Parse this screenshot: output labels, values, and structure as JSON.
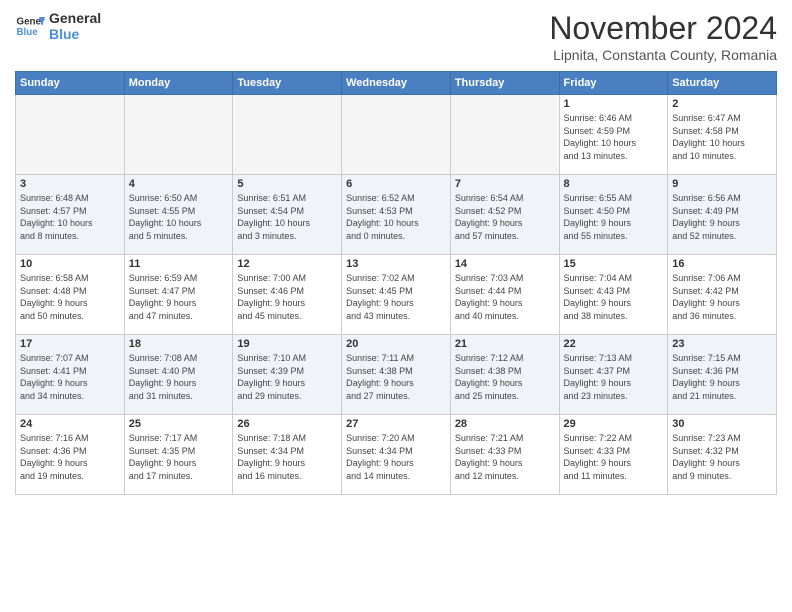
{
  "logo": {
    "line1": "General",
    "line2": "Blue"
  },
  "title": "November 2024",
  "subtitle": "Lipnita, Constanta County, Romania",
  "days_of_week": [
    "Sunday",
    "Monday",
    "Tuesday",
    "Wednesday",
    "Thursday",
    "Friday",
    "Saturday"
  ],
  "weeks": [
    [
      {
        "day": "",
        "info": "",
        "empty": true
      },
      {
        "day": "",
        "info": "",
        "empty": true
      },
      {
        "day": "",
        "info": "",
        "empty": true
      },
      {
        "day": "",
        "info": "",
        "empty": true
      },
      {
        "day": "",
        "info": "",
        "empty": true
      },
      {
        "day": "1",
        "info": "Sunrise: 6:46 AM\nSunset: 4:59 PM\nDaylight: 10 hours\nand 13 minutes."
      },
      {
        "day": "2",
        "info": "Sunrise: 6:47 AM\nSunset: 4:58 PM\nDaylight: 10 hours\nand 10 minutes."
      }
    ],
    [
      {
        "day": "3",
        "info": "Sunrise: 6:48 AM\nSunset: 4:57 PM\nDaylight: 10 hours\nand 8 minutes."
      },
      {
        "day": "4",
        "info": "Sunrise: 6:50 AM\nSunset: 4:55 PM\nDaylight: 10 hours\nand 5 minutes."
      },
      {
        "day": "5",
        "info": "Sunrise: 6:51 AM\nSunset: 4:54 PM\nDaylight: 10 hours\nand 3 minutes."
      },
      {
        "day": "6",
        "info": "Sunrise: 6:52 AM\nSunset: 4:53 PM\nDaylight: 10 hours\nand 0 minutes."
      },
      {
        "day": "7",
        "info": "Sunrise: 6:54 AM\nSunset: 4:52 PM\nDaylight: 9 hours\nand 57 minutes."
      },
      {
        "day": "8",
        "info": "Sunrise: 6:55 AM\nSunset: 4:50 PM\nDaylight: 9 hours\nand 55 minutes."
      },
      {
        "day": "9",
        "info": "Sunrise: 6:56 AM\nSunset: 4:49 PM\nDaylight: 9 hours\nand 52 minutes."
      }
    ],
    [
      {
        "day": "10",
        "info": "Sunrise: 6:58 AM\nSunset: 4:48 PM\nDaylight: 9 hours\nand 50 minutes."
      },
      {
        "day": "11",
        "info": "Sunrise: 6:59 AM\nSunset: 4:47 PM\nDaylight: 9 hours\nand 47 minutes."
      },
      {
        "day": "12",
        "info": "Sunrise: 7:00 AM\nSunset: 4:46 PM\nDaylight: 9 hours\nand 45 minutes."
      },
      {
        "day": "13",
        "info": "Sunrise: 7:02 AM\nSunset: 4:45 PM\nDaylight: 9 hours\nand 43 minutes."
      },
      {
        "day": "14",
        "info": "Sunrise: 7:03 AM\nSunset: 4:44 PM\nDaylight: 9 hours\nand 40 minutes."
      },
      {
        "day": "15",
        "info": "Sunrise: 7:04 AM\nSunset: 4:43 PM\nDaylight: 9 hours\nand 38 minutes."
      },
      {
        "day": "16",
        "info": "Sunrise: 7:06 AM\nSunset: 4:42 PM\nDaylight: 9 hours\nand 36 minutes."
      }
    ],
    [
      {
        "day": "17",
        "info": "Sunrise: 7:07 AM\nSunset: 4:41 PM\nDaylight: 9 hours\nand 34 minutes."
      },
      {
        "day": "18",
        "info": "Sunrise: 7:08 AM\nSunset: 4:40 PM\nDaylight: 9 hours\nand 31 minutes."
      },
      {
        "day": "19",
        "info": "Sunrise: 7:10 AM\nSunset: 4:39 PM\nDaylight: 9 hours\nand 29 minutes."
      },
      {
        "day": "20",
        "info": "Sunrise: 7:11 AM\nSunset: 4:38 PM\nDaylight: 9 hours\nand 27 minutes."
      },
      {
        "day": "21",
        "info": "Sunrise: 7:12 AM\nSunset: 4:38 PM\nDaylight: 9 hours\nand 25 minutes."
      },
      {
        "day": "22",
        "info": "Sunrise: 7:13 AM\nSunset: 4:37 PM\nDaylight: 9 hours\nand 23 minutes."
      },
      {
        "day": "23",
        "info": "Sunrise: 7:15 AM\nSunset: 4:36 PM\nDaylight: 9 hours\nand 21 minutes."
      }
    ],
    [
      {
        "day": "24",
        "info": "Sunrise: 7:16 AM\nSunset: 4:36 PM\nDaylight: 9 hours\nand 19 minutes."
      },
      {
        "day": "25",
        "info": "Sunrise: 7:17 AM\nSunset: 4:35 PM\nDaylight: 9 hours\nand 17 minutes."
      },
      {
        "day": "26",
        "info": "Sunrise: 7:18 AM\nSunset: 4:34 PM\nDaylight: 9 hours\nand 16 minutes."
      },
      {
        "day": "27",
        "info": "Sunrise: 7:20 AM\nSunset: 4:34 PM\nDaylight: 9 hours\nand 14 minutes."
      },
      {
        "day": "28",
        "info": "Sunrise: 7:21 AM\nSunset: 4:33 PM\nDaylight: 9 hours\nand 12 minutes."
      },
      {
        "day": "29",
        "info": "Sunrise: 7:22 AM\nSunset: 4:33 PM\nDaylight: 9 hours\nand 11 minutes."
      },
      {
        "day": "30",
        "info": "Sunrise: 7:23 AM\nSunset: 4:32 PM\nDaylight: 9 hours\nand 9 minutes."
      }
    ]
  ]
}
